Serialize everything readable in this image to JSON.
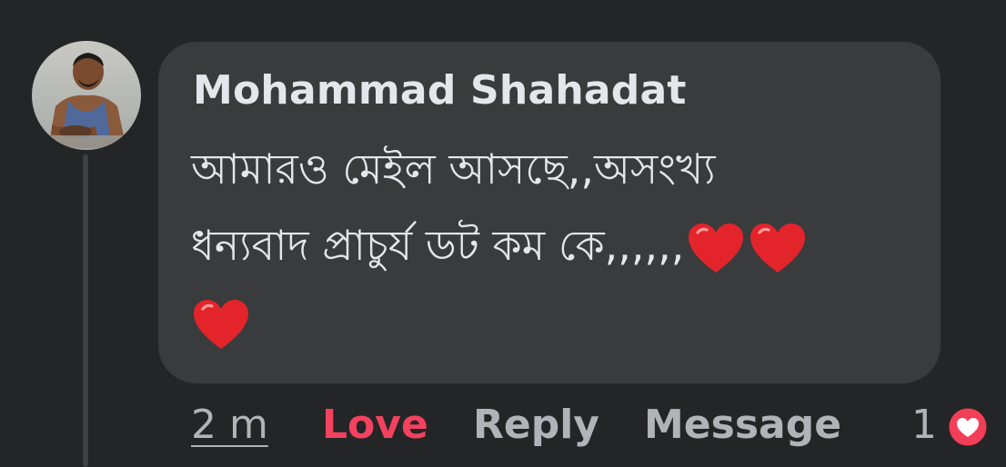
{
  "comment": {
    "author": "Mohammad Shahadat",
    "text_lines": [
      "আমারও মেইল আসছে,,অসংখ্য",
      "ধন্যবাদ প্রাচুর্য ডট কম কে,,,,,,"
    ],
    "emoji_icons": [
      "red-heart-icon",
      "red-heart-icon",
      "red-heart-icon"
    ]
  },
  "actions": {
    "time": "2 m",
    "love": "Love",
    "reply": "Reply",
    "message": "Message"
  },
  "reactions": {
    "count": "1",
    "icon": "love-reaction-icon"
  },
  "colors": {
    "background": "#242526",
    "bubble": "#3a3b3c",
    "text": "#e4e6eb",
    "secondary_text": "#b0b3b8",
    "love": "#f3425f"
  }
}
